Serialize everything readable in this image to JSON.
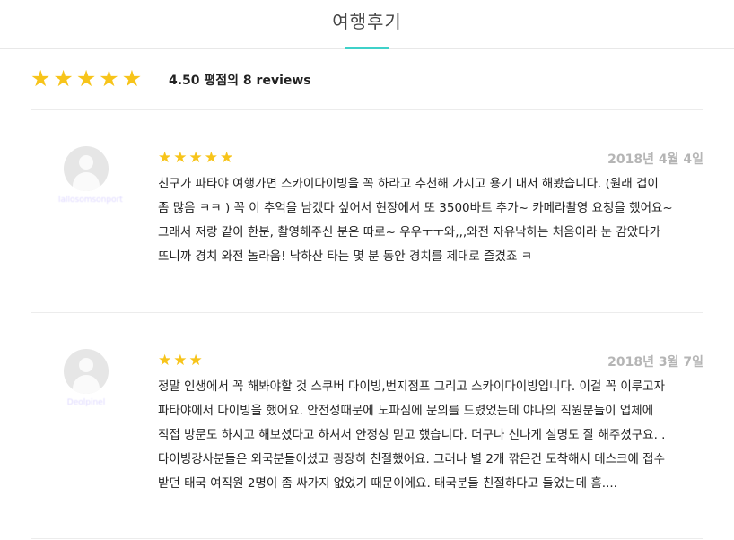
{
  "header": {
    "title": "여행후기"
  },
  "summary": {
    "rating_value": 4.5,
    "star_count": 5,
    "text": "4.50 평점의 8 reviews"
  },
  "colors": {
    "accent": "#3fd1c9",
    "star": "#f7c41a",
    "date": "#b5b5b5"
  },
  "reviews": [
    {
      "stars": 5,
      "date": "2018년 4월 4일",
      "author": "lallosomsonport",
      "text": "친구가 파타야 여행가면 스카이다이빙을 꼭 하라고 추천해 가지고 용기 내서 해봤습니다. (원래 겁이\n좀 많음 ㅋㅋ ) 꼭 이 추억을 남겠다 싶어서 현장에서 또 3500바트 추가~ 카메라촬영 요청을 했어요~\n그래서 저랑 같이 한분, 촬영해주신 분은 따로~ 우우ㅜㅜ와,,,와전 자유낙하는 처음이라 눈 감았다가\n뜨니까 경치 와전 놀라움! 낙하산 타는 몇 분 동안 경치를 제대로 즐겼죠 ㅋ"
    },
    {
      "stars": 3,
      "date": "2018년 3월 7일",
      "author": "Deolpinel",
      "text": "정말 인생에서 꼭 해봐야할 것 스쿠버 다이빙,번지점프 그리고 스카이다이빙입니다. 이걸 꼭 이루고자\n파타야에서 다이빙을 했어요. 안전성때문에 노파심에 문의를 드렸었는데 야나의 직원분들이 업체에\n직접 방문도 하시고 해보셨다고 하셔서 안정성 믿고 했습니다. 더구나 신나게 설명도 잘 해주셨구요. .\n다이빙강사분들은 외국분들이셨고 굉장히 친절했어요. 그러나 별 2개 깎은건 도착해서 데스크에 접수\n받던 태국 여직원 2명이 좀 싸가지 없었기 때문이에요. 태국분들 친절하다고 들었는데 흠...."
    }
  ]
}
